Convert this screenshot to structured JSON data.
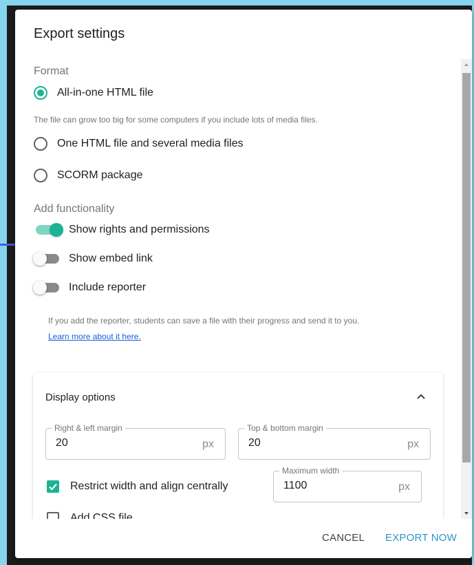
{
  "dialog": {
    "title": "Export settings"
  },
  "format": {
    "label": "Format",
    "options": [
      {
        "label": "All-in-one HTML file",
        "selected": true
      },
      {
        "label": "One HTML file and several media files",
        "selected": false
      },
      {
        "label": "SCORM package",
        "selected": false
      }
    ],
    "hint": "The file can grow too big for some computers if you include lots of media files."
  },
  "functionality": {
    "label": "Add functionality",
    "toggles": [
      {
        "label": "Show rights and permissions",
        "on": true
      },
      {
        "label": "Show embed link",
        "on": false
      },
      {
        "label": "Include reporter",
        "on": false
      }
    ],
    "reporter_hint": "If you add the reporter, students can save a file with their progress and send it to you.",
    "learn_more": "Learn more about it here."
  },
  "display_options": {
    "title": "Display options",
    "expanded": true,
    "side_margin": {
      "legend": "Right & left margin",
      "value": "20",
      "unit": "px"
    },
    "vertical_margin": {
      "legend": "Top & bottom margin",
      "value": "20",
      "unit": "px"
    },
    "restrict_width": {
      "label": "Restrict width and align centrally",
      "checked": true
    },
    "max_width": {
      "legend": "Maximum width",
      "value": "1100",
      "unit": "px"
    },
    "add_css": {
      "label": "Add CSS file",
      "checked": false
    }
  },
  "actions": {
    "cancel": "CANCEL",
    "export": "EXPORT NOW"
  },
  "colors": {
    "accent": "#1bb394",
    "primary_button": "#2b96c9",
    "link": "#1a5fd6",
    "backdrop": "#87d4ef"
  }
}
